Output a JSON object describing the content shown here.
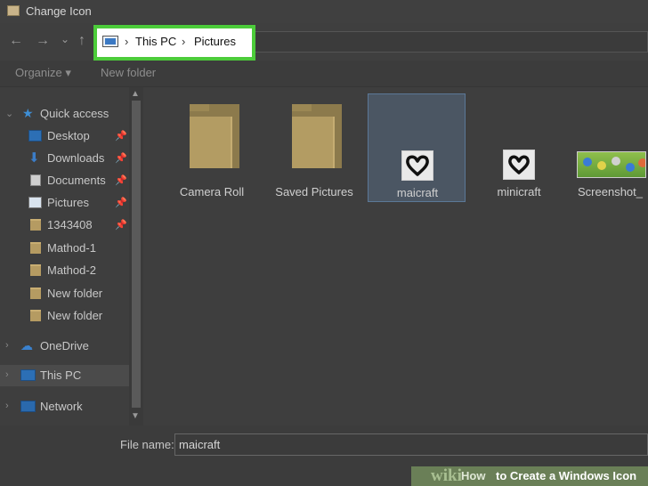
{
  "window": {
    "title": "Change Icon"
  },
  "nav": {
    "back": "←",
    "forward": "→",
    "recent": "⌄",
    "up": "↑",
    "sep": "›",
    "breadcrumb": [
      "This PC",
      "Pictures"
    ]
  },
  "toolbar": {
    "organize": "Organize ▾",
    "new_folder": "New folder"
  },
  "sidebar": {
    "items": [
      {
        "label": "Quick access",
        "icon": "star-icon"
      },
      {
        "label": "Desktop",
        "icon": "desktop-icon",
        "pinned": true
      },
      {
        "label": "Downloads",
        "icon": "download-icon",
        "pinned": true
      },
      {
        "label": "Documents",
        "icon": "document-icon",
        "pinned": true
      },
      {
        "label": "Pictures",
        "icon": "pictures-icon",
        "pinned": true
      },
      {
        "label": "1343408",
        "icon": "folder-icon",
        "pinned": true
      },
      {
        "label": "Mathod-1",
        "icon": "folder-icon"
      },
      {
        "label": "Mathod-2",
        "icon": "folder-icon"
      },
      {
        "label": "New folder",
        "icon": "folder-icon"
      },
      {
        "label": "New folder",
        "icon": "folder-icon"
      },
      {
        "label": "OneDrive",
        "icon": "cloud-icon"
      },
      {
        "label": "This PC",
        "icon": "computer-icon",
        "selected": true
      },
      {
        "label": "Network",
        "icon": "network-icon"
      }
    ]
  },
  "files": [
    {
      "name": "Camera Roll",
      "type": "folder"
    },
    {
      "name": "Saved Pictures",
      "type": "folder"
    },
    {
      "name": "maicraft",
      "type": "image",
      "selected": true
    },
    {
      "name": "minicraft",
      "type": "image"
    },
    {
      "name": "Screenshot_",
      "type": "image"
    }
  ],
  "bottom": {
    "file_name_label": "File name:",
    "file_name_value": "maicraft"
  },
  "watermark": {
    "wiki": "wiki",
    "how": "How",
    "rest": "to Create a Windows Icon"
  },
  "colors": {
    "highlight_border": "#4ccc3a",
    "selection": "#4b5663",
    "folder": "#b39c63"
  }
}
